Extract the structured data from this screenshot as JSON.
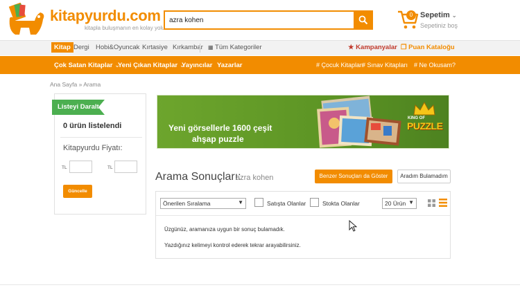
{
  "header": {
    "logo_text": "kitapyurdu.com",
    "tagline": "kitapla buluşmanın en kolay yolu",
    "search_value": "azra kohen",
    "cart": {
      "count": "0",
      "title": "Sepetim",
      "subtitle": "Sepetiniz boş"
    }
  },
  "top_nav": {
    "items": [
      "Kitap",
      "Dergi",
      "Hobi&Oyuncak",
      "Kırtasiye",
      "Kırkambar",
      "Tüm Kategoriler"
    ],
    "campaigns": "Kampanyalar",
    "points": "Puan Kataloğu"
  },
  "main_nav": {
    "items": [
      "Çok Satan Kitaplar",
      "Yeni Çıkan Kitaplar",
      "Yayıncılar",
      "Yazarlar"
    ],
    "tags": [
      "# Çocuk Kitapları",
      "# Sınav Kitapları",
      "# Ne Okusam?"
    ]
  },
  "breadcrumb": "Ana Sayfa » Arama",
  "sidebar": {
    "badge": "Listeyi Daralt",
    "count_text": "0 ürün listelendi",
    "price_title": "Kitapyurdu Fiyatı:",
    "currency": "TL",
    "update_button": "Güncelle"
  },
  "banner": {
    "line1": "Yeni görsellerle 1600 çeşit",
    "line2": "ahşap puzzle",
    "brand_small": "KING OF",
    "brand_big": "PUZZLE"
  },
  "results": {
    "title": "Arama Sonuçları:",
    "query": "azra kohen",
    "similar_button": "Benzer Sonuçları da Göster",
    "notfound_button": "Aradım Bulamadım",
    "sort_value": "Önerilen Sıralama",
    "on_sale_label": "Satışta Olanlar",
    "in_stock_label": "Stokta Olanlar",
    "per_page_value": "20 Ürün",
    "message1": "Üzgünüz, aramanıza uygun bir sonuç bulamadık.",
    "message2": "Yazdığınız kelimeyi kontrol ederek tekrar arayabilirsiniz."
  },
  "colors": {
    "accent": "#f28c00",
    "green": "#4caf50",
    "campaign_red": "#c0392b"
  }
}
